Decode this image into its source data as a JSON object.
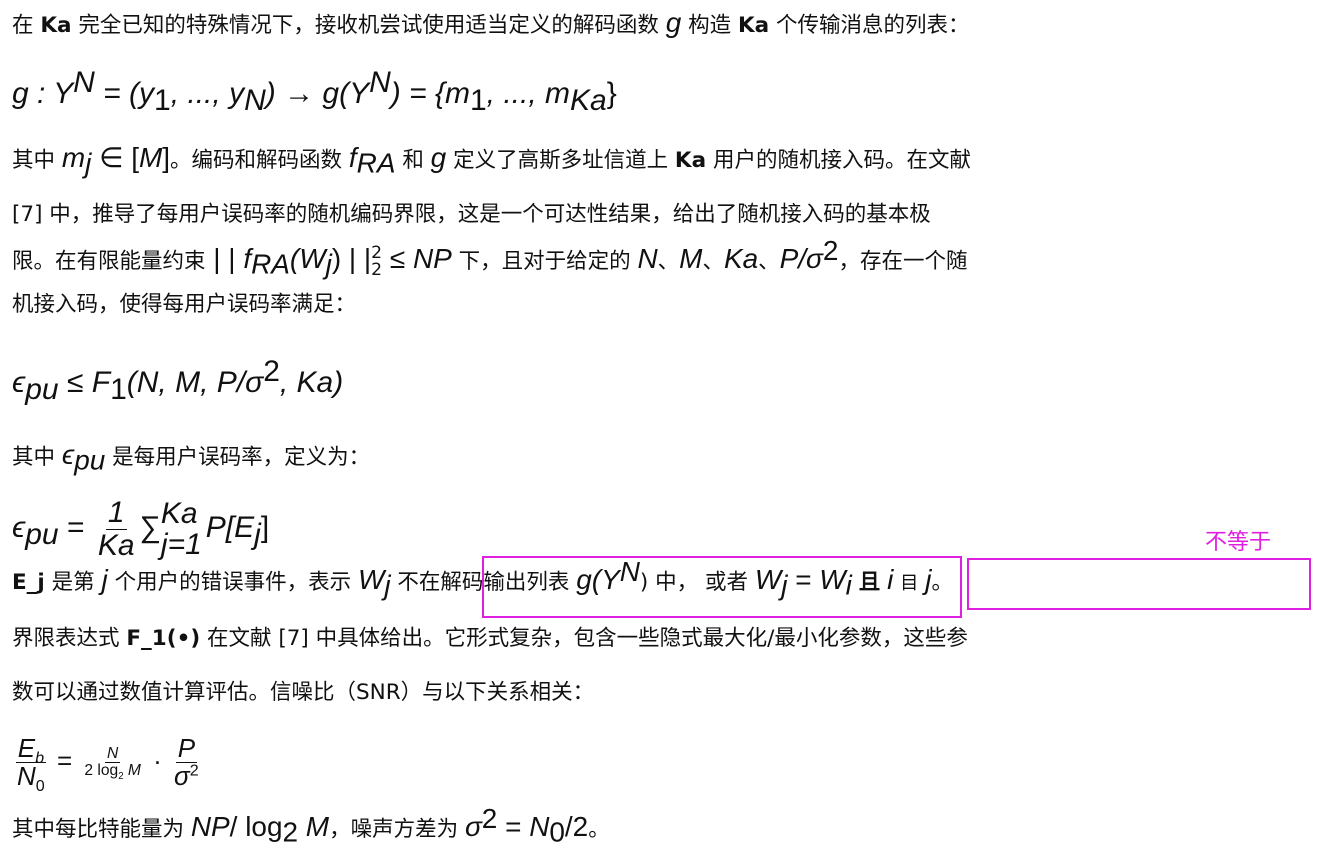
{
  "paragraph1": {
    "t1": "在",
    "ka1": "Ka",
    "t2": "完全已知的特殊情况下，接收机尝试使用适当定义的解码函数",
    "g": "g",
    "t3": "构造",
    "ka2": "Ka",
    "t4": "个传输消息的列表："
  },
  "formula1": {
    "lhs": "g : Y",
    "lhs_sup": "N",
    "mid": " = (y",
    "y1_sub": "1",
    "dots": ", ..., y",
    "yn_sub": "N",
    "arrow": ") → g(Y",
    "g_sup": "N",
    "rhs": ") = {m",
    "m1_sub": "1",
    "rhs2": ", ..., m",
    "mka_sub": "Ka",
    "end": "}"
  },
  "paragraph2": {
    "t1": "其中",
    "mj": "m",
    "mj_sub": "j",
    "in": " ∈ [",
    "M": "M",
    "close": "]",
    "t2": "。编码和解码函数",
    "f": "f",
    "f_sub": "RA",
    "t3": "和",
    "g": "g",
    "t4": "定义了高斯多址信道上",
    "ka": "Ka",
    "t5": "用户的随机接入码。在文献",
    "line2": "[7] 中，推导了每用户误码率的随机编码界限，这是一个可达性结果，给出了随机接入码的基本极",
    "l3a": "限。在有限能量约束",
    "norm_open": " | | ",
    "nf": "f",
    "nf_sub": "RA",
    "nW": "(W",
    "nW_sub": "j",
    "norm_close": ") | |",
    "norm_sup": "2",
    "norm_sub": "2",
    "le": " ≤ ",
    "NP": "NP",
    "l3b": "下，且对于给定的",
    "N": "N",
    "sep1": "、",
    "M2": "M",
    "sep2": "、",
    "Ka3": "Ka",
    "sep3": "、",
    "P": "P/σ",
    "P_sup": "2",
    "l3c": "，存在一个随",
    "line4": "机接入码，使得每用户误码率满足："
  },
  "formula2": {
    "eps": "ϵ",
    "eps_sub": "pu",
    "le": " ≤ ",
    "F": "F",
    "F_sub": "1",
    "args": "(N, M, P/σ",
    "args_sup": "2",
    "args2": ", Ka)"
  },
  "paragraph3": {
    "t1": "其中",
    "eps": "ϵ",
    "eps_sub": "pu",
    "t2": "是每用户误码率，定义为："
  },
  "formula3": {
    "eps": "ϵ",
    "eps_sub": "pu",
    "eq": " = ",
    "frac_num": "1",
    "frac_den": "Ka",
    "sum": "∑",
    "sum_top": "Ka",
    "sum_bot": "j=1",
    "P": "P[E",
    "P_sub": "j",
    "close": "]"
  },
  "annotation": {
    "text": "不等于",
    "color": "#e020e0"
  },
  "paragraph4": {
    "ej": "E_j",
    "t1": "是第",
    "j": "j",
    "t2": "个用户的错误事件，表示",
    "W": "W",
    "W_sub": "j",
    "t3": "不在解码输出列表",
    "g": "g(Y",
    "g_sup": "N",
    "t4": ") 中，",
    "t5": "或者",
    "W2": "W",
    "W2_sub": "j",
    "eq": " = ",
    "W3": "W",
    "W3_sub": "i",
    "qie": "且",
    "i": "i",
    "ne_glyph": "目",
    "j2": "j",
    "end": "。"
  },
  "paragraph5": {
    "t1": "界限表达式",
    "F": "F_1(•)",
    "t2": "在文献 [7] 中具体给出。它形式复杂，包含一些隐式最大化/最小化参数，这些参",
    "line2": "数可以通过数值计算评估。信噪比（SNR）与以下关系相关："
  },
  "formula4": {
    "f1_num": "E",
    "f1_num_sub": "b",
    "f1_den": "N",
    "f1_den_sub": "0",
    "eq": " = ",
    "f2_num": "N",
    "f2_den": "2 log",
    "f2_den_sub": "2",
    "f2_den_M": " M",
    "dot": " · ",
    "f3_num": "P",
    "f3_den": "σ",
    "f3_den_sup": "2"
  },
  "paragraph6": {
    "t1": "其中每比特能量为",
    "NP": "NP",
    "slash": "/ log",
    "log_sub": "2",
    "M": " M",
    "t2": "，噪声方差为",
    "sigma": "σ",
    "sigma_sup": "2",
    "eq": " = ",
    "N0": "N",
    "N0_sub": "0",
    "tail": "/2",
    "end": "。"
  }
}
